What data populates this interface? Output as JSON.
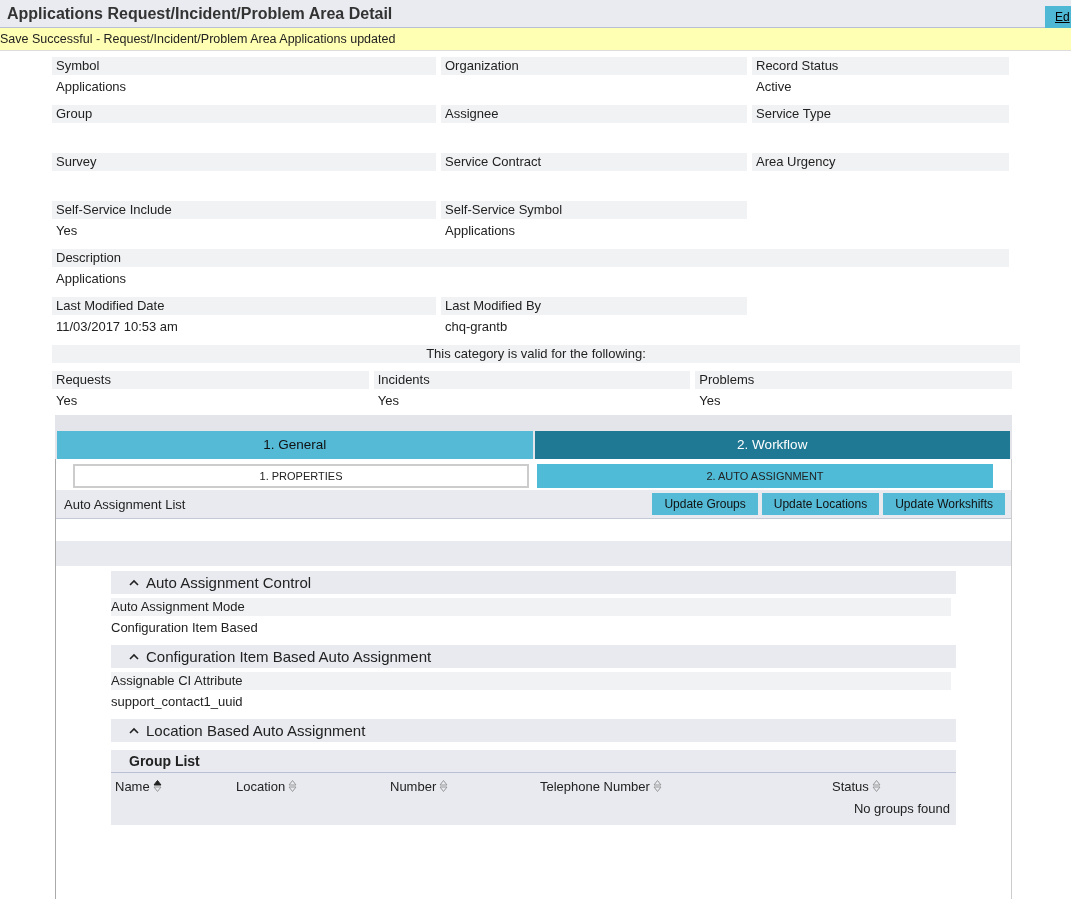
{
  "header": {
    "title": "Applications Request/Incident/Problem Area Detail",
    "button": "Ed"
  },
  "message": "Save Successful - Request/Incident/Problem Area Applications updated",
  "fields": [
    [
      {
        "label": "Symbol",
        "value": "Applications"
      },
      {
        "label": "Organization"
      },
      {
        "label": "Record Status",
        "value": "Active"
      }
    ],
    [
      {
        "label": "Group"
      },
      {
        "label": "Assignee"
      },
      {
        "label": "Service Type"
      }
    ],
    [
      {
        "label": "Survey"
      },
      {
        "label": "Service Contract"
      },
      {
        "label": "Area Urgency"
      }
    ],
    [
      {
        "label": "Self-Service Include",
        "value": "Yes"
      },
      {
        "label": "Self-Service Symbol",
        "value": "Applications"
      }
    ],
    [
      {
        "label": "Description",
        "value": "Applications"
      }
    ],
    [
      {
        "label": "Last Modified Date",
        "value": "11/03/2017 10:53 am"
      },
      {
        "label": "Last Modified By",
        "value": "chq-grantb"
      }
    ]
  ],
  "validity": {
    "heading": "This category is valid for the following:",
    "items": [
      {
        "label": "Requests",
        "value": "Yes"
      },
      {
        "label": "Incidents",
        "value": "Yes"
      },
      {
        "label": "Problems",
        "value": "Yes"
      }
    ]
  },
  "tabs": [
    {
      "label": "1. General",
      "selected": false
    },
    {
      "label": "2. Workflow",
      "selected": true
    }
  ],
  "subtabs": [
    {
      "label": "1. PROPERTIES",
      "selected": false
    },
    {
      "label": "2. AUTO ASSIGNMENT",
      "selected": true
    }
  ],
  "toolbar": {
    "title": "Auto Assignment List",
    "buttons": [
      "Update Groups",
      "Update Locations",
      "Update Workshifts"
    ]
  },
  "sections": [
    {
      "title": "Auto Assignment Control",
      "expanded": true,
      "fields": [
        {
          "label": "Auto Assignment Mode",
          "value": "Configuration Item Based"
        }
      ]
    },
    {
      "title": "Configuration Item Based Auto Assignment",
      "expanded": true,
      "fields": [
        {
          "label": "Assignable CI Attribute",
          "value": "support_contact1_uuid"
        }
      ]
    },
    {
      "title": "Location Based Auto Assignment",
      "expanded": true,
      "group_list": {
        "title": "Group List",
        "columns": [
          {
            "label": "Name",
            "sorted": true
          },
          {
            "label": "Location",
            "sorted": false
          },
          {
            "label": "Number",
            "sorted": false
          },
          {
            "label": "Telephone Number",
            "sorted": false
          },
          {
            "label": "Status",
            "sorted": false
          }
        ],
        "empty": "No groups found"
      }
    }
  ]
}
